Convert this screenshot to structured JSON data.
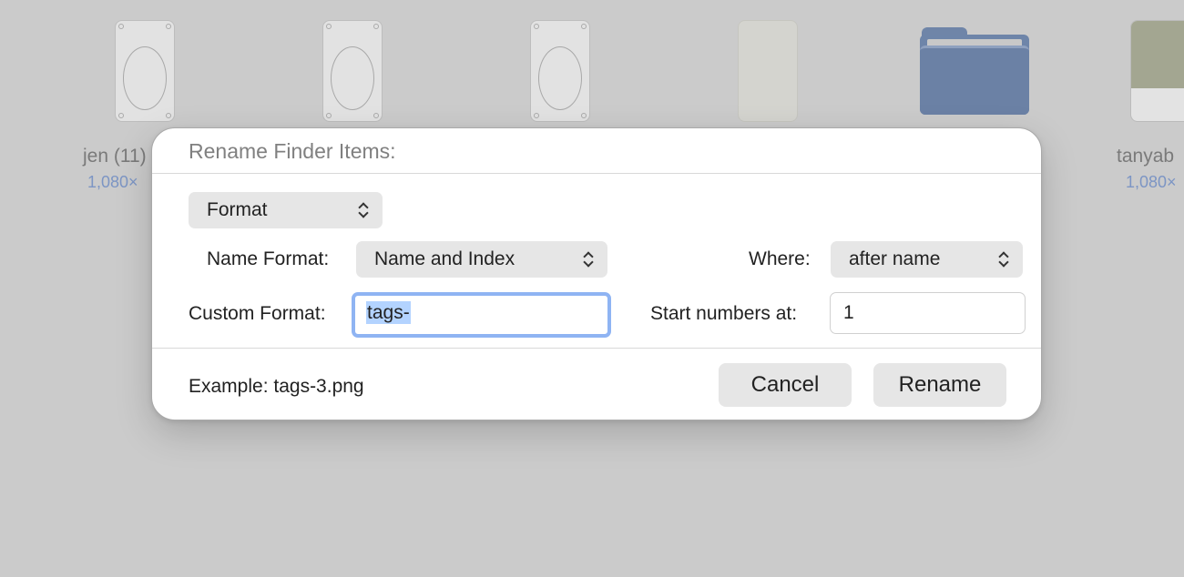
{
  "background_files": [
    {
      "icon": "card-file-icon"
    },
    {
      "icon": "card-file-icon"
    },
    {
      "icon": "card-file-icon"
    },
    {
      "icon": "plain-file-icon"
    },
    {
      "icon": "folder-icon"
    },
    {
      "icon": "image-file-icon"
    }
  ],
  "file_labels": {
    "left_name": "jen (11)",
    "left_dim": "1,080×",
    "right_name": "tanyab",
    "right_dim": "1,080×"
  },
  "dialog": {
    "title": "Rename Finder Items:",
    "mode_popup": "Format",
    "name_format_label": "Name Format:",
    "name_format_value": "Name and Index",
    "where_label": "Where:",
    "where_value": "after name",
    "custom_format_label": "Custom Format:",
    "custom_format_value": "tags-",
    "start_numbers_label": "Start numbers at:",
    "start_numbers_value": "1",
    "example_text": "Example: tags-3.png",
    "cancel_label": "Cancel",
    "rename_label": "Rename"
  },
  "colors": {
    "background": "#cbcbcb",
    "focus_ring": "#8fb4f3",
    "selection": "#b3d3ff",
    "folder": "#6e85a9"
  }
}
